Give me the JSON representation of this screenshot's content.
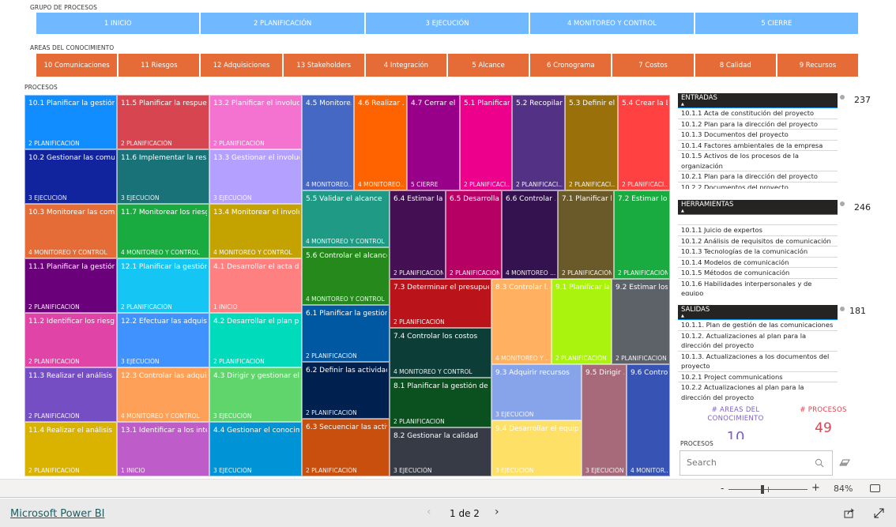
{
  "grupo": {
    "label": "GRUPO DE PROCESOS",
    "items": [
      "1 INICIO",
      "2 PLANIFICACIÓN",
      "3 EJECUCIÓN",
      "4 MONITOREO Y CONTROL",
      "5 CIERRE"
    ]
  },
  "areas": {
    "label": "AREAS DEL CONOCIMIENTO",
    "items": [
      "10 Comunicaciones",
      "11 Riesgos",
      "12 Adquisiciones",
      "13 Stakeholders",
      "4 Integración",
      "5 Alcance",
      "6 Cronograma",
      "7 Costos",
      "8 Calidad",
      "9 Recursos"
    ]
  },
  "procesos": {
    "label": "PROCESOS",
    "tiles": [
      {
        "title": "10.1 Planificar la gestión ...",
        "group": "2 PLANIFICACIÓN",
        "color": "#118dff"
      },
      {
        "title": "10.2 Gestionar las comun...",
        "group": "3 EJECUCIÓN",
        "color": "#12239e"
      },
      {
        "title": "10.3 Monitorear las comu...",
        "group": "4 MONITOREO Y CONTROL",
        "color": "#e66c37"
      },
      {
        "title": "11.1 Planificar la gestión ...",
        "group": "2 PLANIFICACIÓN",
        "color": "#6b007b"
      },
      {
        "title": "11.2 Identificar los riesgos",
        "group": "2 PLANIFICACIÓN",
        "color": "#e044a7"
      },
      {
        "title": "11.3 Realizar el análisis cu...",
        "group": "2 PLANIFICACIÓN",
        "color": "#744ec2"
      },
      {
        "title": "11.4 Realizar el análisis cu...",
        "group": "2 PLANIFICACIÓN",
        "color": "#d9b300"
      },
      {
        "title": "11.5 Planificar la respuest...",
        "group": "2 PLANIFICACIÓN",
        "color": "#d64550"
      },
      {
        "title": "11.6 Implementar la resp...",
        "group": "3 EJECUCIÓN",
        "color": "#197278"
      },
      {
        "title": "11.7 Monitorear los riesgos",
        "group": "4 MONITOREO Y CONTROL",
        "color": "#1aab40"
      },
      {
        "title": "12.1 Planificar la gestión ...",
        "group": "2 PLANIFICACIÓN",
        "color": "#15c6f4"
      },
      {
        "title": "12.2 Efectuar las adquisici...",
        "group": "3 EJECUCIÓN",
        "color": "#4092ff"
      },
      {
        "title": "12.3 Controlar las adquisi...",
        "group": "4 MONITOREO Y CONTROL",
        "color": "#ffa058"
      },
      {
        "title": "13.1 Identificar a los inter...",
        "group": "1 INICIO",
        "color": "#be5dc9"
      },
      {
        "title": "13.2 Planificar el involucr...",
        "group": "2 PLANIFICACIÓN",
        "color": "#f472d0"
      },
      {
        "title": "13.3 Gestionar el involucr...",
        "group": "3 EJECUCIÓN",
        "color": "#b4a0ff"
      },
      {
        "title": "13.4 Monitorear el involu...",
        "group": "4 MONITOREO Y CONTROL",
        "color": "#c4a200"
      },
      {
        "title": "4.1 Desarrollar el acta de ...",
        "group": "1 INICIO",
        "color": "#ff8080"
      },
      {
        "title": "4.2 Desarrollar el plan par...",
        "group": "2 PLANIFICACIÓN",
        "color": "#00dbbc"
      },
      {
        "title": "4.3 Dirigir y gestionar el t...",
        "group": "3 EJECUCIÓN",
        "color": "#5fd56b"
      },
      {
        "title": "4.4 Gestionar el conocimi...",
        "group": "3 EJECUCIÓN",
        "color": "#0093d5"
      },
      {
        "title": "4.5 Monitore...",
        "group": "4 MONITOREO...",
        "color": "#4668c5"
      },
      {
        "title": "4.6 Realizar ...",
        "group": "4 MONITOREO...",
        "color": "#ff6300"
      },
      {
        "title": "4.7 Cerrar el ...",
        "group": "5 CIERRE",
        "color": "#99008a"
      },
      {
        "title": "5.1 Planificar...",
        "group": "2 PLANIFICACI...",
        "color": "#ec008c"
      },
      {
        "title": "5.2 Recopilar...",
        "group": "2 PLANIFICACI...",
        "color": "#533285"
      },
      {
        "title": "5.3 Definir el...",
        "group": "2 PLANIFICACI...",
        "color": "#99700a"
      },
      {
        "title": "5.4 Crear la E...",
        "group": "2 PLANIFICACI...",
        "color": "#ff4141"
      },
      {
        "title": "5.5 Validar el alcance",
        "group": "4 MONITOREO Y CONTROL",
        "color": "#1f9a85"
      },
      {
        "title": "5.6 Controlar el alcance",
        "group": "4 MONITOREO Y CONTROL",
        "color": "#25891c"
      },
      {
        "title": "6.1 Planificar la gestión ...",
        "group": "2 PLANIFICACIÓN",
        "color": "#0057a2"
      },
      {
        "title": "6.2 Definir las actividades",
        "group": "2 PLANIFICACIÓN",
        "color": "#002050"
      },
      {
        "title": "6.3 Secuenciar las activi...",
        "group": "2 PLANIFICACIÓN",
        "color": "#c94f0f"
      },
      {
        "title": "6.4 Estimar la ...",
        "group": "2 PLANIFICACIÓN",
        "color": "#450f54"
      },
      {
        "title": "6.5 Desarrolla...",
        "group": "2 PLANIFICACIÓN",
        "color": "#b60064"
      },
      {
        "title": "6.6 Controlar ...",
        "group": "4 MONITOREO ...",
        "color": "#34124f"
      },
      {
        "title": "7.1 Planificar l...",
        "group": "2 PLANIFICACIÓN",
        "color": "#6a5a29"
      },
      {
        "title": "7.2 Estimar lo...",
        "group": "2 PLANIFICACIÓN",
        "color": "#1aab40"
      },
      {
        "title": "7.3 Determinar el presupuesto",
        "group": "2 PLANIFICACIÓN",
        "color": "#ba141a"
      },
      {
        "title": "7.4 Controlar los costos",
        "group": "4 MONITOREO Y CONTROL",
        "color": "#0c3d37"
      },
      {
        "title": "8.1 Planificar la gestión de la...",
        "group": "2 PLANIFICACIÓN",
        "color": "#0b511f"
      },
      {
        "title": "8.2 Gestionar la calidad",
        "group": "3 EJECUCIÓN",
        "color": "#373b45"
      },
      {
        "title": "8.3 Controlar l...",
        "group": "4 MONITOREO Y ...",
        "color": "#ffb060"
      },
      {
        "title": "9.1 Planificar la...",
        "group": "2 PLANIFICACIÓN",
        "color": "#aaf30f"
      },
      {
        "title": "9.2 Estimar los ...",
        "group": "2 PLANIFICACIÓN",
        "color": "#5d6168"
      },
      {
        "title": "9.3 Adquirir recursos",
        "group": "3 EJECUCIÓN",
        "color": "#87a3ea"
      },
      {
        "title": "9.4 Desarrollar el equipo",
        "group": "3 EJECUCIÓN",
        "color": "#ffe066"
      },
      {
        "title": "9.5 Dirigir ...",
        "group": "3 EJECUCIÓN",
        "color": "#a66a7a"
      },
      {
        "title": "9.6 Contro...",
        "group": "4 MONITOR...",
        "color": "#3754b5"
      }
    ]
  },
  "entradas": {
    "header": "ENTRADAS",
    "count": "237",
    "rows": [
      "10.1.1 Acta de constitución del proyecto",
      "10.1.2 Plan para la dirección del proyecto",
      "10.1.3 Documentos del proyecto",
      "10.1.4 Factores ambientales de la empresa",
      "10.1.5 Activos de los procesos de la organización",
      "10.2.1 Plan para la dirección del proyecto",
      "10.2.2 Documentos del proyecto"
    ]
  },
  "herramientas": {
    "header": "HERRAMIENTAS",
    "count": "246",
    "rows": [
      "",
      "10.1.1 Juicio de expertos",
      "10.1.2 Análisis de requisitos de comunicación",
      "10.1.3 Tecnologías de la comunicación",
      "10.1.4 Modelos de comunicación",
      "10.1.5 Métodos de comunicación",
      "10.1.6 Habilidades interpersonales y de equipo"
    ]
  },
  "salidas": {
    "header": "SALIDAS",
    "count": "181",
    "rows": [
      "10.1.1. Plan de gestión de las comunicaciones",
      "10.1.2. Actualizaciones al plan para la dirección del proyecto",
      "10.1.3. Actualizaciones a los documentos del proyecto",
      "10.2.1 Project communications",
      "10.2.2 Actualizaciones al plan para la dirección del proyecto"
    ]
  },
  "kpis": {
    "areas": {
      "label": "# AREAS DEL CONOCIMIENTO",
      "value": "10",
      "color": "#7d5fc8"
    },
    "procesos": {
      "label": "# PROCESOS",
      "value": "49",
      "color": "#e0404f"
    }
  },
  "search_slicer": {
    "label": "PROCESOS",
    "placeholder": "Search"
  },
  "zoom": {
    "minus": "-",
    "plus": "+",
    "level": "84%",
    "value_percent": 84
  },
  "footer": {
    "brand": "Microsoft Power BI",
    "page": "1 de 2"
  }
}
